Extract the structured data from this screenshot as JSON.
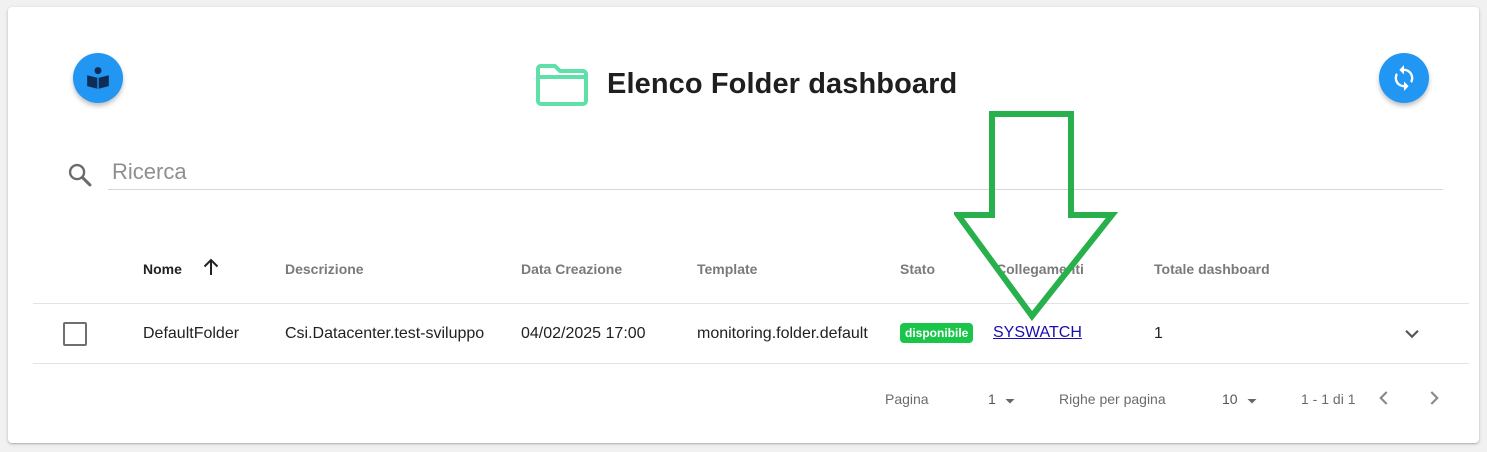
{
  "header": {
    "title": "Elenco Folder dashboard",
    "left_button_icon": "book-reader-icon",
    "folder_icon": "folder-icon",
    "refresh_button_icon": "refresh-icon"
  },
  "search": {
    "placeholder": "Ricerca",
    "value": ""
  },
  "table": {
    "columns": [
      "Nome",
      "Descrizione",
      "Data Creazione",
      "Template",
      "Stato",
      "Collegamenti",
      "Totale dashboard"
    ],
    "sort": {
      "column": "Nome",
      "direction": "ascending"
    },
    "rows": [
      {
        "selected": false,
        "nome": "DefaultFolder",
        "descrizione": "Csi.Datacenter.test-sviluppo",
        "data_creazione": "04/02/2025 17:00",
        "template": "monitoring.folder.default",
        "stato": "disponibile",
        "collegamenti": "SYSWATCH",
        "totale_dashboard": "1"
      }
    ]
  },
  "pagination": {
    "page_label": "Pagina",
    "page_value": "1",
    "rows_label": "Righe per pagina",
    "rows_value": "10",
    "range_text": "1 - 1 di 1"
  },
  "colors": {
    "accent": "#2196f3",
    "folder": "#5fe0a8",
    "status_available": "#19c649",
    "annotation_arrow": "#27b04c",
    "link": "#1a0dab"
  }
}
